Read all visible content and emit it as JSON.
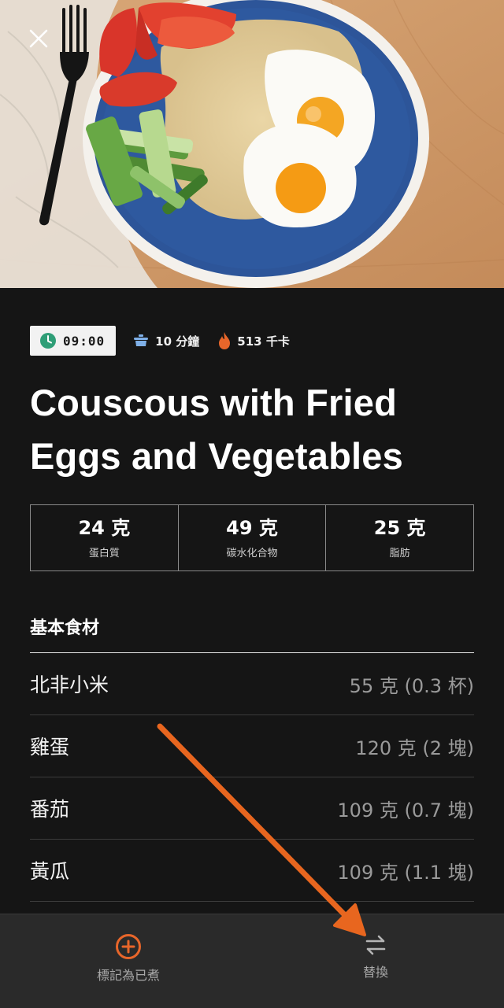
{
  "hero": {
    "image": "plate of couscous with fried eggs, tomato wedges and cucumber sticks, fork on linen"
  },
  "header": {
    "close_icon": "close-icon"
  },
  "meta": {
    "time": "09:00",
    "cook_time": "10 分鐘",
    "calories": "513 千卡"
  },
  "recipe": {
    "title": "Couscous with Fried Eggs and Vegetables"
  },
  "macros": [
    {
      "value": "24 克",
      "label": "蛋白質"
    },
    {
      "value": "49 克",
      "label": "碳水化合物"
    },
    {
      "value": "25 克",
      "label": "脂肪"
    }
  ],
  "ingredients": {
    "section_title": "基本食材",
    "items": [
      {
        "name": "北非小米",
        "amount": "55 克 (0.3 杯)"
      },
      {
        "name": "雞蛋",
        "amount": "120 克 (2 塊)"
      },
      {
        "name": "番茄",
        "amount": "109 克 (0.7 塊)"
      },
      {
        "name": "黃瓜",
        "amount": "109 克 (1.1 塊)"
      }
    ]
  },
  "bottom_bar": {
    "mark_cooked_label": "標記為已煮",
    "replace_label": "替換"
  },
  "colors": {
    "accent_orange": "#e8662a",
    "clock_green": "#2f9e77",
    "pot_blue": "#7fb0e8",
    "annotation_arrow": "#e8661f"
  }
}
